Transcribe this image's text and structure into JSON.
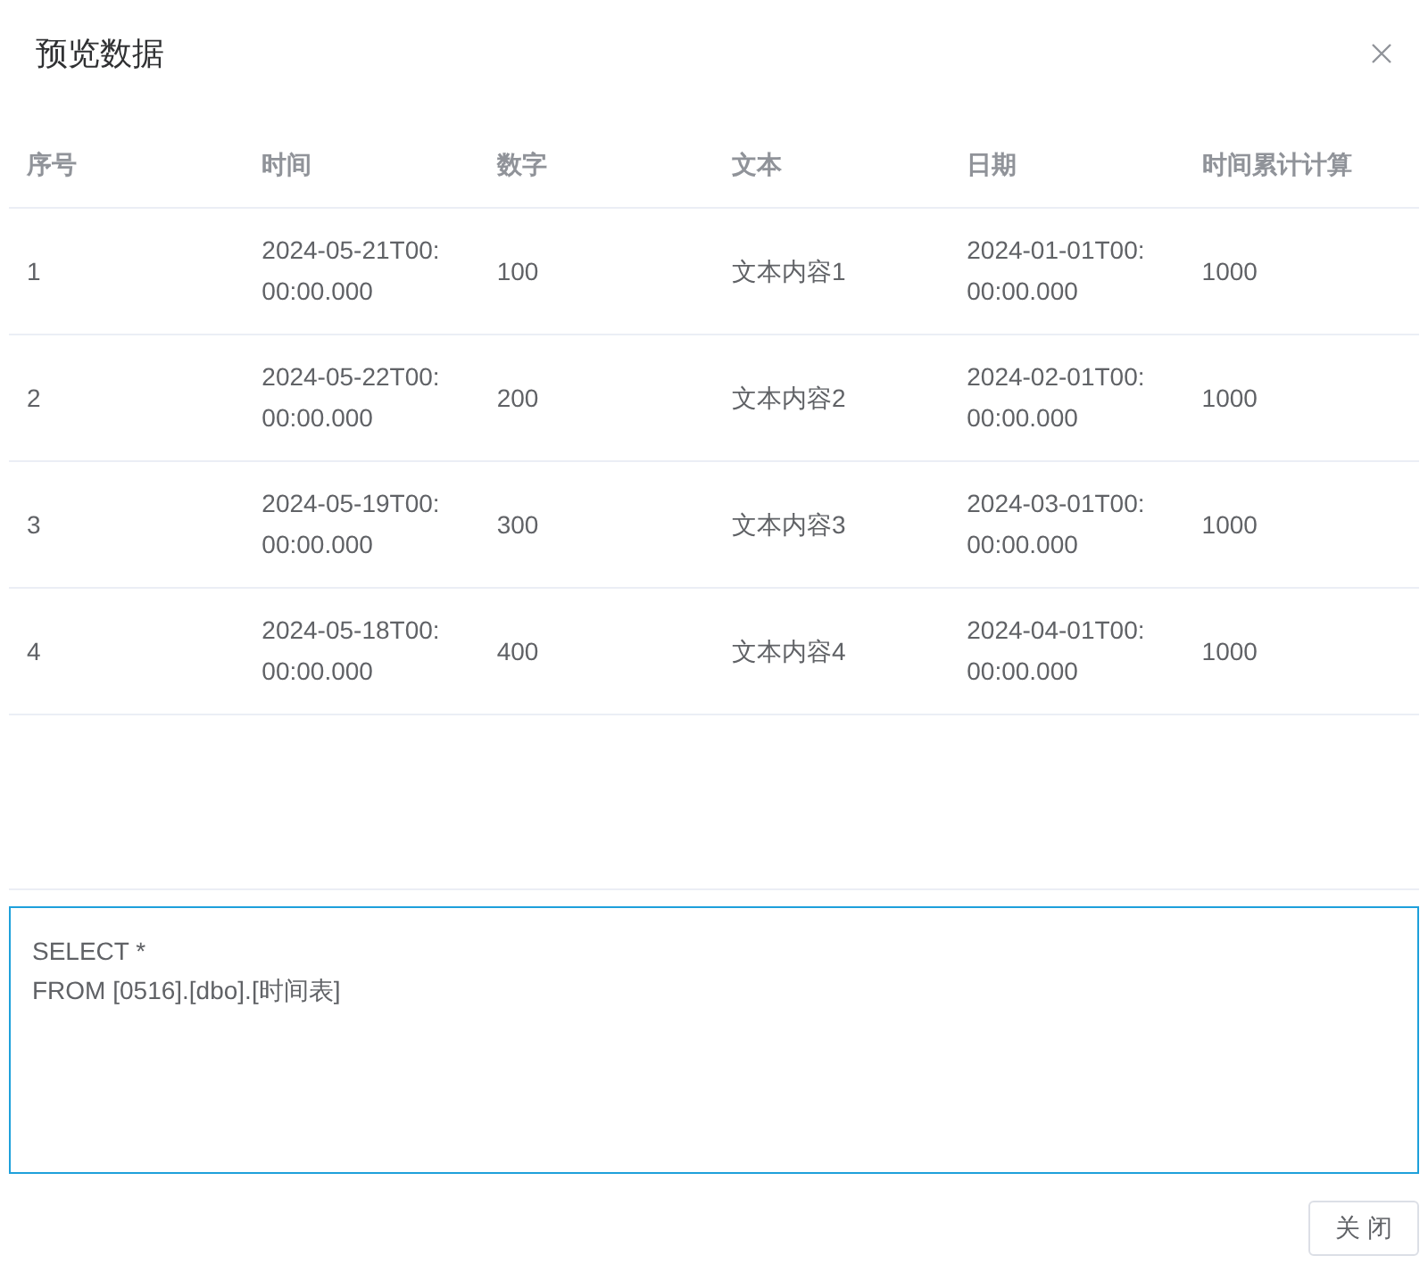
{
  "dialog": {
    "title": "预览数据"
  },
  "table": {
    "columns": [
      "序号",
      "时间",
      "数字",
      "文本",
      "日期",
      "时间累计计算"
    ],
    "rows": [
      [
        "1",
        "2024-05-21T00:00:00.000",
        "100",
        "文本内容1",
        "2024-01-01T00:00:00.000",
        "1000"
      ],
      [
        "2",
        "2024-05-22T00:00:00.000",
        "200",
        "文本内容2",
        "2024-02-01T00:00:00.000",
        "1000"
      ],
      [
        "3",
        "2024-05-19T00:00:00.000",
        "300",
        "文本内容3",
        "2024-03-01T00:00:00.000",
        "1000"
      ],
      [
        "4",
        "2024-05-18T00:00:00.000",
        "400",
        "文本内容4",
        "2024-04-01T00:00:00.000",
        "1000"
      ]
    ]
  },
  "sql_editor": {
    "value": "SELECT *\nFROM [0516].[dbo].[时间表]"
  },
  "buttons": [
    "关 闭"
  ]
}
